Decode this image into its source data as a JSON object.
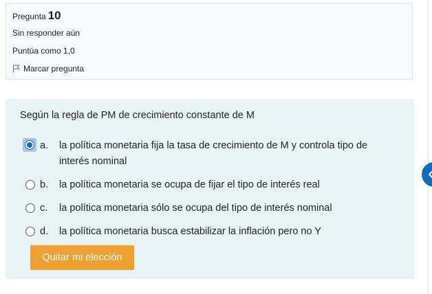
{
  "question_info": {
    "label": "Pregunta",
    "number": "10",
    "state": "Sin responder aún",
    "grade": "Puntúa como 1,0",
    "flag_label": "Marcar pregunta",
    "flag_icon": "flag-icon"
  },
  "question": {
    "text": "Según la regla de PM de crecimiento constante de M",
    "options": [
      {
        "letter": "a.",
        "text": "la política monetaria fija la tasa de crecimiento de M y controla tipo de interés nominal",
        "selected": true
      },
      {
        "letter": "b.",
        "text": "la política monetaria se ocupa de fijar el tipo de interés real",
        "selected": false
      },
      {
        "letter": "c.",
        "text": "la política monetaria sólo se ocupa del tipo de interés nominal",
        "selected": false
      },
      {
        "letter": "d.",
        "text": "la política monetaria busca estabilizar la inflación pero no Y",
        "selected": false
      }
    ],
    "clear_button": "Quitar mi elección"
  },
  "drawer_toggle": {
    "icon": "chevron-left-icon"
  },
  "colors": {
    "info_background": "#f8f9fa",
    "content_background": "#e7f3f5",
    "button_background": "#f0a030",
    "accent": "#0f6cbf"
  }
}
